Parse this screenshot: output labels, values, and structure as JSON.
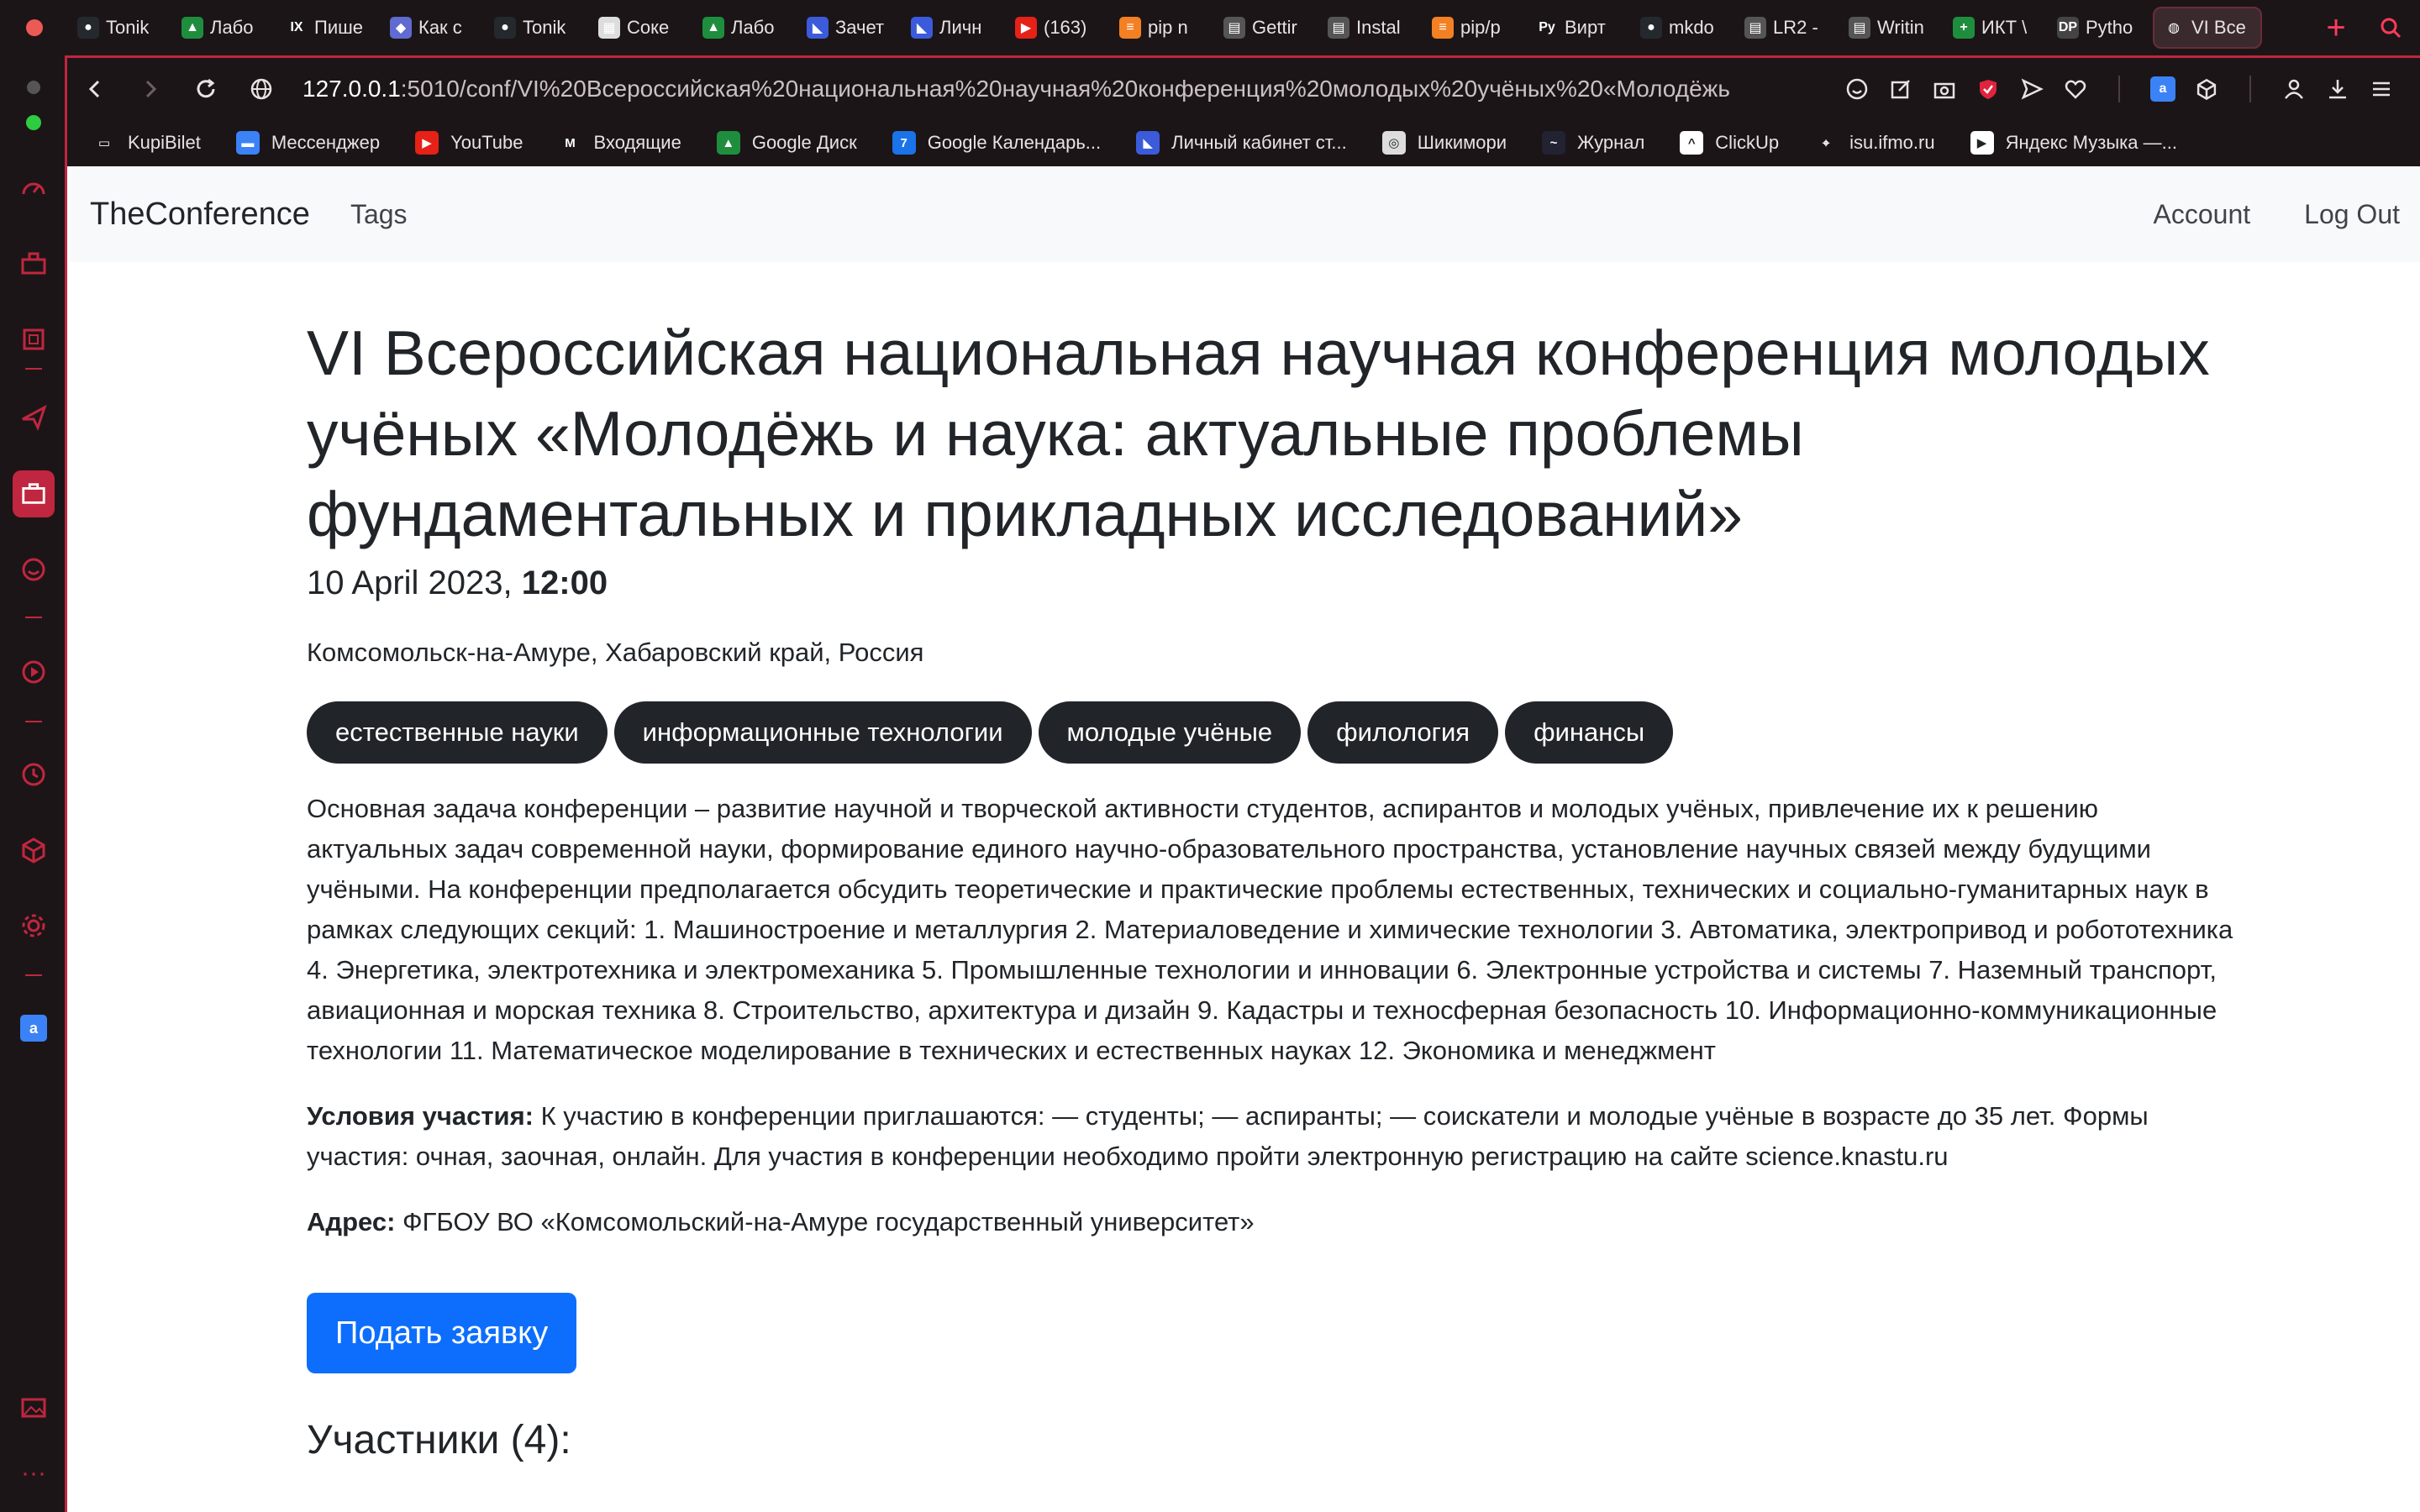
{
  "browser": {
    "tabs": [
      {
        "label": "Tonik",
        "icon": "github-icon",
        "color": "#24292e",
        "glyph": "●"
      },
      {
        "label": "Лабо",
        "icon": "google-drive-icon",
        "color": "#1e8e3e",
        "glyph": "▲"
      },
      {
        "label": "Пише",
        "icon": "ix-icon",
        "color": "#1c1517",
        "glyph": "IX"
      },
      {
        "label": "Как с",
        "icon": "doc-icon",
        "color": "#5f6bd1",
        "glyph": "◆"
      },
      {
        "label": "Tonik",
        "icon": "github-icon",
        "color": "#24292e",
        "glyph": "●"
      },
      {
        "label": "Соке",
        "icon": "page-icon",
        "color": "#ddd",
        "glyph": "▦"
      },
      {
        "label": "Лабо",
        "icon": "google-drive-icon",
        "color": "#1e8e3e",
        "glyph": "▲"
      },
      {
        "label": "Зачет",
        "icon": "itmo-icon",
        "color": "#3b5bdb",
        "glyph": "◣"
      },
      {
        "label": "Личн",
        "icon": "itmo-icon",
        "color": "#3b5bdb",
        "glyph": "◣"
      },
      {
        "label": "(163)",
        "icon": "youtube-icon",
        "color": "#e62117",
        "glyph": "▶"
      },
      {
        "label": "pip n",
        "icon": "stackoverflow-icon",
        "color": "#f48024",
        "glyph": "≡"
      },
      {
        "label": "Gettir",
        "icon": "book-icon",
        "color": "#555",
        "glyph": "▤"
      },
      {
        "label": "Instal",
        "icon": "book-icon",
        "color": "#555",
        "glyph": "▤"
      },
      {
        "label": "pip/p",
        "icon": "stackoverflow-icon",
        "color": "#f48024",
        "glyph": "≡"
      },
      {
        "label": "Вирт",
        "icon": "py-icon",
        "color": "#1c1517",
        "glyph": "Ру"
      },
      {
        "label": "mkdo",
        "icon": "github-icon",
        "color": "#24292e",
        "glyph": "●"
      },
      {
        "label": "LR2 -",
        "icon": "book-icon",
        "color": "#555",
        "glyph": "▤"
      },
      {
        "label": "Writin",
        "icon": "book-icon",
        "color": "#555",
        "glyph": "▤"
      },
      {
        "label": "ИКТ \\",
        "icon": "sheets-icon",
        "color": "#1e8e3e",
        "glyph": "+"
      },
      {
        "label": "Pytho",
        "icon": "dp-icon",
        "color": "#444",
        "glyph": "DP"
      },
      {
        "label": "VI Все",
        "icon": "globe-icon",
        "color": "#3a2a2e",
        "glyph": "◍",
        "active": true
      }
    ],
    "url_host": "127.0.0.1",
    "url_path": ":5010/conf/VI%20Всероссийская%20национальная%20научная%20конференция%20молодых%20учёных%20«Молодёжь",
    "bookmarks": [
      {
        "label": "KupiBilet",
        "icon": "folder-icon",
        "color": "transparent",
        "glyph": "▭"
      },
      {
        "label": "Мессенджер",
        "icon": "messenger-icon",
        "color": "#3b82f6",
        "glyph": "▬"
      },
      {
        "label": "YouTube",
        "icon": "youtube-icon",
        "color": "#e62117",
        "glyph": "▶"
      },
      {
        "label": "Входящие",
        "icon": "gmail-icon",
        "color": "transparent",
        "glyph": "M"
      },
      {
        "label": "Google Диск",
        "icon": "google-drive-icon",
        "color": "#1e8e3e",
        "glyph": "▲"
      },
      {
        "label": "Google Календарь...",
        "icon": "calendar-icon",
        "color": "#1a73e8",
        "glyph": "7"
      },
      {
        "label": "Личный кабинет ст...",
        "icon": "itmo-icon",
        "color": "#3b5bdb",
        "glyph": "◣"
      },
      {
        "label": "Шикимори",
        "icon": "shikimori-icon",
        "color": "#ddd",
        "glyph": "◎"
      },
      {
        "label": "Журнал",
        "icon": "journal-icon",
        "color": "#223",
        "glyph": "~"
      },
      {
        "label": "ClickUp",
        "icon": "clickup-icon",
        "color": "#fff",
        "glyph": "^"
      },
      {
        "label": "isu.ifmo.ru",
        "icon": "isu-icon",
        "color": "transparent",
        "glyph": "⌖"
      },
      {
        "label": "Яндекс Музыка —...",
        "icon": "yandex-music-icon",
        "color": "#fff",
        "glyph": "▶"
      }
    ]
  },
  "site": {
    "brand": "TheConference",
    "nav_tags": "Tags",
    "nav_account": "Account",
    "nav_logout": "Log Out"
  },
  "conference": {
    "title": "VI Всероссийская национальная научная конференция молодых учёных «Молодёжь и наука: актуальные проблемы фундаментальных и прикладных исследований»",
    "date": "10 April 2023,",
    "time": "12:00",
    "location": "Комсомольск-на-Амуре, Хабаровский край, Россия",
    "tags": [
      "естественные науки",
      "информационные технологии",
      "молодые учёные",
      "филология",
      "финансы"
    ],
    "description": "Основная задача конференции – развитие научной и творческой активности студентов, аспирантов и молодых учёных, привлечение их к решению актуальных задач современной науки, формирование единого научно-образовательного пространства, установление научных связей между будущими учёными. На конференции предполагается обсудить теоретические и практические проблемы естественных, технических и социально-гуманитарных наук в рамках следующих секций: 1. Машиностроение и металлургия 2. Материаловедение и химические технологии 3. Автоматика, электропривод и робототехника 4. Энергетика, электротехника и электромеханика 5. Промышленные технологии и инновации 6. Электронные устройства и системы 7. Наземный транспорт, авиационная и морская техника 8. Строительство, архитектура и дизайн 9. Кадастры и техносферная безопасность 10. Информационно-коммуникационные технологии 11. Математическое моделирование в технических и естественных науках 12. Экономика и менеджмент",
    "conditions_label": "Условия участия:",
    "conditions": "К участию в конференции приглашаются: — студенты; — аспиранты; — соискатели и молодые учёные в возрасте до 35 лет. Формы участия: очная, заочная, онлайн. Для участия в конференции необходимо пройти электронную регистрацию на сайте science.knastu.ru",
    "address_label": "Адрес:",
    "address": "ФГБОУ ВО «Комсомольский-на-Амуре государственный университет»",
    "apply_button": "Подать заявку",
    "participants_heading": "Участники (4):"
  },
  "colors": {
    "accent": "#0d6efd",
    "chrome": "#1c1517",
    "chrome_accent": "#c0263f",
    "tag_bg": "#212529"
  }
}
